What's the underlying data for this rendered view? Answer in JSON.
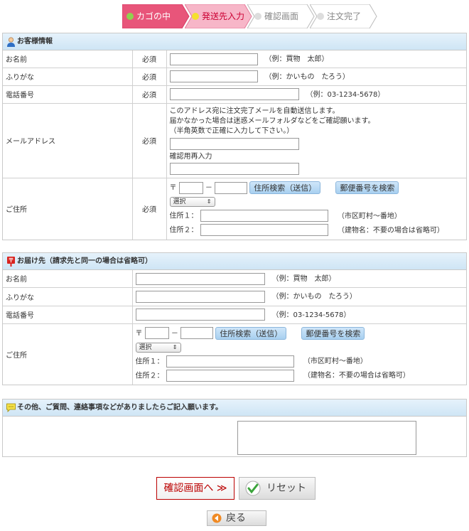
{
  "steps": [
    {
      "label": "カゴの中",
      "state": "done",
      "color": "#e8557a",
      "dot": "#8fd14f"
    },
    {
      "label": "発送先入力",
      "state": "current",
      "color": "#f7b6c8",
      "dot": "#f5e02e"
    },
    {
      "label": "確認画面",
      "state": "todo",
      "color": "#ffffff",
      "dot": "#dddddd"
    },
    {
      "label": "注文完了",
      "state": "todo",
      "color": "#ffffff",
      "dot": "#dddddd"
    }
  ],
  "customer": {
    "heading": "お客様情報",
    "required": "必須",
    "name_label": "お名前",
    "name_example": "（例：買物　太郎）",
    "kana_label": "ふりがな",
    "kana_example": "（例：かいもの　たろう）",
    "tel_label": "電話番号",
    "tel_example": "（例：03-1234-5678）",
    "mail_label": "メールアドレス",
    "mail_note1": "このアドレス宛に注文完了メールを自動送信します。",
    "mail_note2": "届かなかった場合は迷惑メールフォルダなどをご確認願います。",
    "mail_note3": "（半角英数で正確に入力して下さい。）",
    "mail_confirm_label": "確認用再入力",
    "addr_label": "ご住所",
    "postal_mark": "〒",
    "postal_dash": "－",
    "addr_search_btn": "住所検索（送信）",
    "zip_search_btn": "郵便番号を検索",
    "pref_select": "選択",
    "addr1_label": "住所１：",
    "addr1_example": "（市区町村～番地）",
    "addr2_label": "住所２：",
    "addr2_example": "（建物名：不要の場合は省略可）"
  },
  "delivery": {
    "heading": "お届け先（請求先と同一の場合は省略可）",
    "name_label": "お名前",
    "name_example": "（例：買物　太郎）",
    "kana_label": "ふりがな",
    "kana_example": "（例：かいもの　たろう）",
    "tel_label": "電話番号",
    "tel_example": "（例：03-1234-5678）",
    "addr_label": "ご住所",
    "postal_mark": "〒",
    "postal_dash": "－",
    "addr_search_btn": "住所検索（送信）",
    "zip_search_btn": "郵便番号を検索",
    "pref_select": "選択",
    "addr1_label": "住所１：",
    "addr1_example": "（市区町村～番地）",
    "addr2_label": "住所２：",
    "addr2_example": "（建物名：不要の場合は省略可）"
  },
  "other": {
    "heading": "その他、ご質問、連絡事項などがありましたらご記入願います。"
  },
  "buttons": {
    "confirm": "確認画面へ ≫",
    "reset": "リセット",
    "back": "戻る"
  }
}
